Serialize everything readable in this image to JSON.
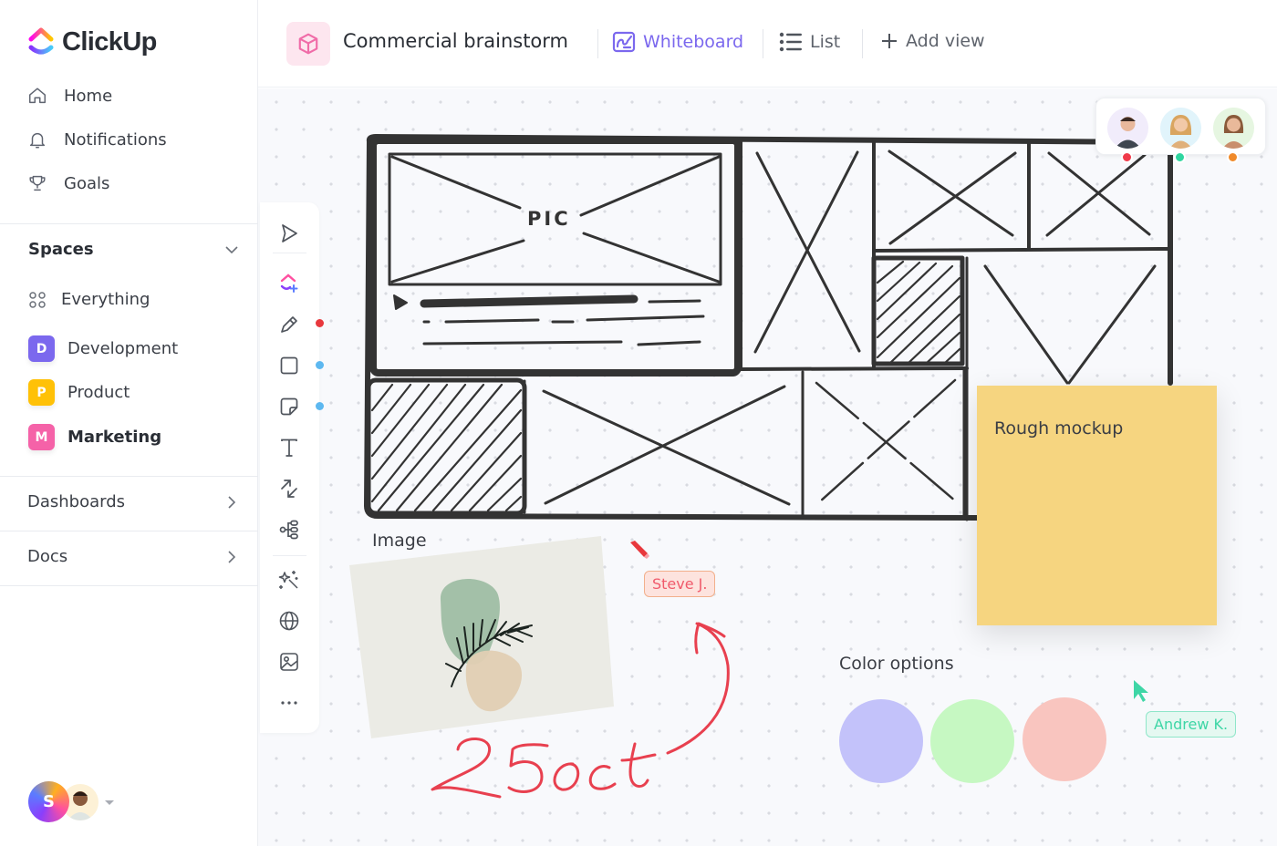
{
  "app": {
    "name": "ClickUp"
  },
  "sidebar": {
    "nav": [
      {
        "label": "Home",
        "icon": "home-icon"
      },
      {
        "label": "Notifications",
        "icon": "bell-icon"
      },
      {
        "label": "Goals",
        "icon": "trophy-icon"
      }
    ],
    "spaces_title": "Spaces",
    "spaces": [
      {
        "label": "Everything",
        "icon": "grid-dots-icon"
      },
      {
        "label": "Development",
        "badge": "D",
        "color": "#7b68ee"
      },
      {
        "label": "Product",
        "badge": "P",
        "color": "#ffc107"
      },
      {
        "label": "Marketing",
        "badge": "M",
        "color": "#f562a8"
      }
    ],
    "sections": [
      {
        "label": "Dashboards"
      },
      {
        "label": "Docs"
      }
    ],
    "user_initial": "S"
  },
  "header": {
    "title": "Commercial brainstorm",
    "tabs": [
      {
        "label": "Whiteboard",
        "active": true
      },
      {
        "label": "List",
        "active": false
      }
    ],
    "add_view": "Add view"
  },
  "toolbar": {
    "tools": [
      "select",
      "clickup-ai-add",
      "pen",
      "rectangle",
      "sticky-note",
      "text",
      "connector",
      "mind-map",
      "ai-magic",
      "embed-web",
      "image",
      "more"
    ],
    "tool_colors": {
      "pen": "#e8383d",
      "rectangle": "#5db8f0",
      "sticky-note": "#5db8f0"
    }
  },
  "presence": {
    "users": [
      {
        "status_color": "#f03a4a",
        "bg": "#f1ecfb"
      },
      {
        "status_color": "#2fd6a0",
        "bg": "#e1f4fb"
      },
      {
        "status_color": "#f08a2a",
        "bg": "#e6f6e1"
      }
    ]
  },
  "canvas": {
    "wireframe_label": "PIC",
    "sticky_note": {
      "text": "Rough mockup",
      "color": "#f6d580"
    },
    "image_label": "Image",
    "handwriting": "25 oct",
    "color_options_label": "Color options",
    "swatches": [
      "#c3c2fa",
      "#c6f8c2",
      "#f9c5bf"
    ],
    "cursors": [
      {
        "name": "Steve J.",
        "color": "#f05a6b"
      },
      {
        "name": "Andrew K.",
        "color": "#3ed6a6"
      }
    ]
  }
}
